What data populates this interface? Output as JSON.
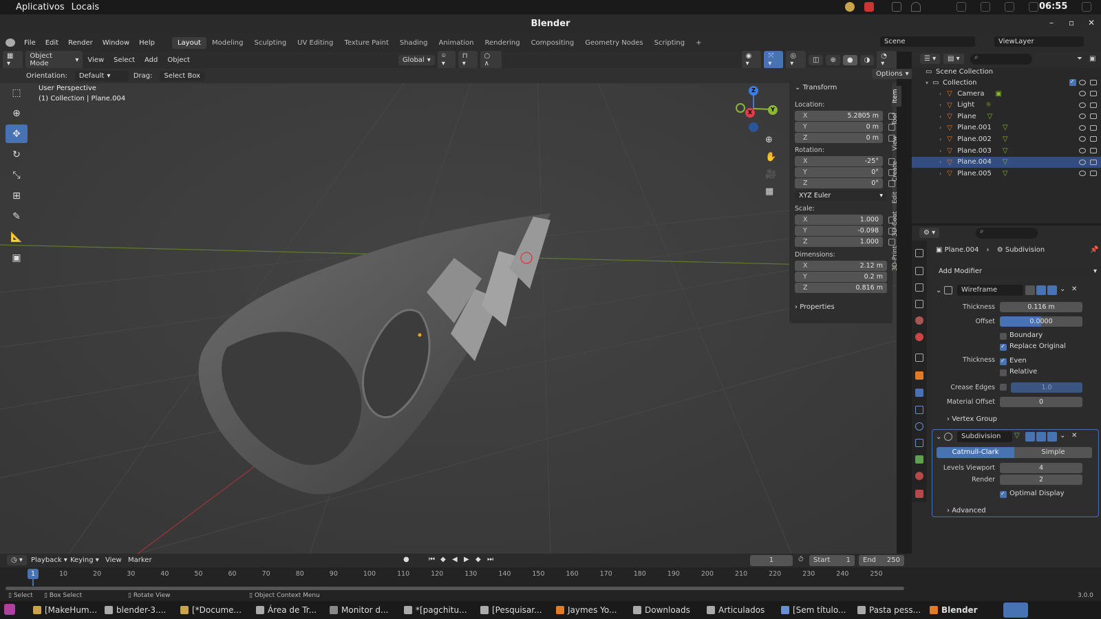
{
  "os": {
    "apps_menu": "Aplicativos",
    "places_menu": "Locais",
    "clock": "06:55"
  },
  "window": {
    "title": "Blender"
  },
  "menubar": {
    "items": [
      "File",
      "Edit",
      "Render",
      "Window",
      "Help"
    ],
    "workspaces": [
      "Layout",
      "Modeling",
      "Sculpting",
      "UV Editing",
      "Texture Paint",
      "Shading",
      "Animation",
      "Rendering",
      "Compositing",
      "Geometry Nodes",
      "Scripting"
    ],
    "active_workspace": "Layout",
    "scene": "Scene",
    "view_layer": "ViewLayer"
  },
  "viewport_header": {
    "mode": "Object Mode",
    "menus": [
      "View",
      "Select",
      "Add",
      "Object"
    ],
    "transform_orientation": "Global",
    "options": "Options"
  },
  "tool_settings": {
    "orientation_label": "Orientation:",
    "orientation_value": "Default",
    "drag_label": "Drag:",
    "drag_value": "Select Box"
  },
  "viewport": {
    "perspective": "User Perspective",
    "collection_info": "(1) Collection | Plane.004",
    "gizmo": {
      "x": "X",
      "y": "Y",
      "z": "Z"
    }
  },
  "npanel": {
    "section": "Transform",
    "location_label": "Location:",
    "location": [
      {
        "axis": "X",
        "value": "5.2805 m"
      },
      {
        "axis": "Y",
        "value": "0 m"
      },
      {
        "axis": "Z",
        "value": "0 m"
      }
    ],
    "rotation_label": "Rotation:",
    "rotation": [
      {
        "axis": "X",
        "value": "-25°"
      },
      {
        "axis": "Y",
        "value": "0°"
      },
      {
        "axis": "Z",
        "value": "0°"
      }
    ],
    "rotation_mode": "XYZ Euler",
    "scale_label": "Scale:",
    "scale": [
      {
        "axis": "X",
        "value": "1.000"
      },
      {
        "axis": "Y",
        "value": "-0.098"
      },
      {
        "axis": "Z",
        "value": "1.000"
      }
    ],
    "dimensions_label": "Dimensions:",
    "dimensions": [
      {
        "axis": "X",
        "value": "2.12 m"
      },
      {
        "axis": "Y",
        "value": "0.2 m"
      },
      {
        "axis": "Z",
        "value": "0.816 m"
      }
    ],
    "properties": "Properties",
    "tabs": [
      "Item",
      "Tool",
      "View",
      "Create",
      "Edit",
      "3D-Coat",
      "3D-Print"
    ]
  },
  "outliner": {
    "scene_collection": "Scene Collection",
    "collection": "Collection",
    "items": [
      "Camera",
      "Light",
      "Plane",
      "Plane.001",
      "Plane.002",
      "Plane.003",
      "Plane.004",
      "Plane.005"
    ]
  },
  "properties": {
    "breadcrumb_object": "Plane.004",
    "breadcrumb_modifier": "Subdivision",
    "add_modifier": "Add Modifier",
    "wireframe": {
      "name": "Wireframe",
      "thickness_label": "Thickness",
      "thickness": "0.116 m",
      "offset_label": "Offset",
      "offset": "0.0000",
      "boundary": "Boundary",
      "replace_original": "Replace Original",
      "thickness2_label": "Thickness",
      "even": "Even",
      "relative": "Relative",
      "crease_edges_label": "Crease Edges",
      "crease_edges": "1.0",
      "material_offset_label": "Material Offset",
      "material_offset": "0",
      "vertex_group": "Vertex Group"
    },
    "subdivision": {
      "name": "Subdivision",
      "catmull": "Catmull-Clark",
      "simple": "Simple",
      "levels_viewport_label": "Levels Viewport",
      "levels_viewport": "4",
      "render_label": "Render",
      "render": "2",
      "optimal_display": "Optimal Display",
      "advanced": "Advanced"
    }
  },
  "timeline": {
    "menus": [
      "Playback",
      "Keying",
      "View",
      "Marker"
    ],
    "current_frame": "1",
    "start_label": "Start",
    "start": "1",
    "end_label": "End",
    "end": "250",
    "ticks": [
      "10",
      "20",
      "30",
      "40",
      "50",
      "60",
      "70",
      "80",
      "90",
      "100",
      "110",
      "120",
      "130",
      "140",
      "150",
      "160",
      "170",
      "180",
      "190",
      "200",
      "210",
      "220",
      "230",
      "240",
      "250"
    ],
    "playhead": "1"
  },
  "statusbar": {
    "select": "Select",
    "box_select": "Box Select",
    "rotate_view": "Rotate View",
    "context_menu": "Object Context Menu",
    "version": "3.0.0"
  },
  "taskbar": [
    "[MakeHum...",
    "blender-3....",
    "[*Docume...",
    "Área de Tr...",
    "Monitor d...",
    "*[pagchitu...",
    "[Pesquisar...",
    "Jaymes Yo...",
    "Downloads",
    "Articulados",
    "[Sem título...",
    "Pasta pess...",
    "Blender"
  ],
  "colors": {
    "accent": "#4772b3",
    "viewport_bg": "#3d3d3d",
    "panel_bg": "#2b2b2b",
    "x_axis": "#e03c4a",
    "y_axis": "#8ab833",
    "z_axis": "#3c7de0"
  }
}
